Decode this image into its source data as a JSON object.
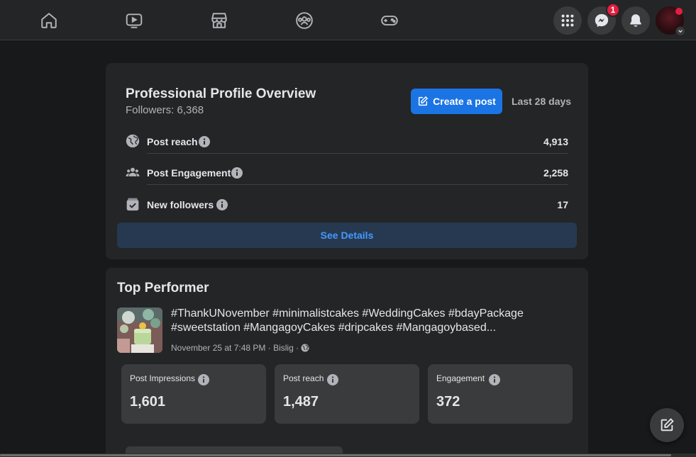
{
  "nav": {
    "icons": [
      "home-icon",
      "watch-icon",
      "marketplace-icon",
      "groups-icon",
      "gaming-icon"
    ],
    "menu_icon": "grid-menu-icon",
    "messenger_icon": "messenger-icon",
    "messenger_badge": "1",
    "notifications_icon": "bell-icon"
  },
  "overview": {
    "title": "Professional Profile Overview",
    "followers": "Followers: 6,368",
    "create_post": "Create a post",
    "range": "Last 28 days",
    "metrics": [
      {
        "icon": "globe-icon",
        "label": "Post reach",
        "value": "4,913"
      },
      {
        "icon": "people-icon",
        "label": "Post Engagement",
        "value": "2,258"
      },
      {
        "icon": "new-followers-icon",
        "label": "New followers",
        "value": "17"
      }
    ],
    "see_details": "See Details"
  },
  "top_performer": {
    "title": "Top Performer",
    "post_line1": "#ThankUNovember #minimalistcakes #WeddingCakes #bdayPackage",
    "post_line2": "#sweetstation #MangagoyCakes #dripcakes #Mangagoybased...",
    "post_meta": "November 25 at 7:48 PM · Bislig ·",
    "stats": [
      {
        "label": "Post Impressions",
        "value": "1,601"
      },
      {
        "label": "Post reach",
        "value": "1,487"
      },
      {
        "label": "Engagement",
        "value": "372"
      }
    ]
  },
  "colors": {
    "accent": "#1b74e4",
    "link": "#4599ff",
    "badge": "#e41e3f",
    "card": "#242526",
    "background": "#18191a"
  }
}
